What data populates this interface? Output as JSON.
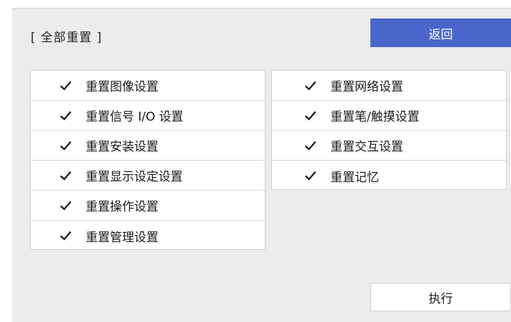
{
  "dialog": {
    "title": "[ 全部重置 ]",
    "back_label": "返回",
    "execute_label": "执行"
  },
  "left_items": [
    {
      "label": "重置图像设置",
      "checked": true
    },
    {
      "label": "重置信号 I/O 设置",
      "checked": true
    },
    {
      "label": "重置安装设置",
      "checked": true
    },
    {
      "label": "重置显示设定设置",
      "checked": true
    },
    {
      "label": "重置操作设置",
      "checked": true
    },
    {
      "label": "重置管理设置",
      "checked": true
    }
  ],
  "right_items": [
    {
      "label": "重置网络设置",
      "checked": true
    },
    {
      "label": "重置笔/触摸设置",
      "checked": true
    },
    {
      "label": "重置交互设置",
      "checked": true
    },
    {
      "label": "重置记忆",
      "checked": true
    }
  ],
  "icons": {
    "check": "check-icon"
  },
  "colors": {
    "accent": "#4a66cc",
    "panel": "#ececec"
  }
}
